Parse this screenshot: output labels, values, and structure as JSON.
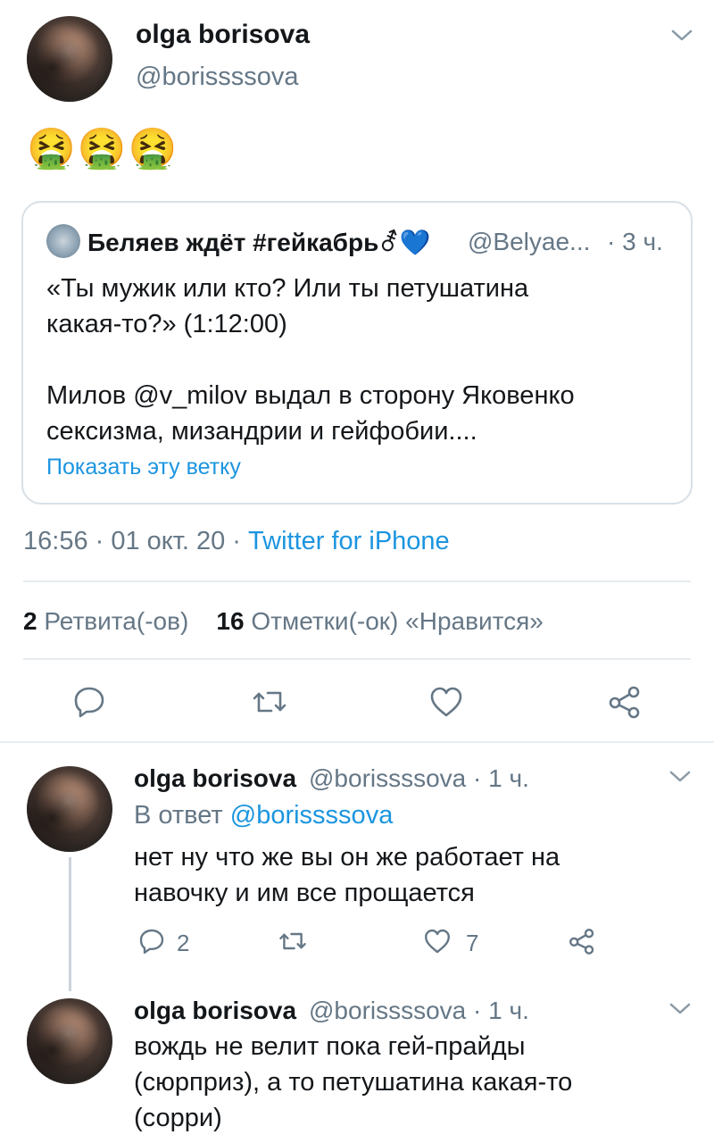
{
  "main_tweet": {
    "author_name": "olga borisova",
    "author_handle": "@borissssova",
    "text": "🤮🤮🤮",
    "quoted": {
      "author_name": "Беляев ждёт #гейкабрь⚦",
      "heart": "💙",
      "author_handle": "@Belyae...",
      "time": "· 3 ч.",
      "lines": [
        "«Ты мужик или кто? Или ты петушатина",
        "какая-то?» (1:12:00)",
        "Милов @v_milov выдал в сторону Яковенко",
        "сексизма, мизандрии и гейфобии...."
      ],
      "show_thread": "Показать эту ветку"
    },
    "timestamp": "16:56 · 01 окт. 20 · ",
    "source": "Twitter for iPhone",
    "retweets_count": "2",
    "retweets_label": "Ретвита(-ов)",
    "likes_count": "16",
    "likes_label": "Отметки(-ок) «Нравится»"
  },
  "replies": [
    {
      "author_name": "olga borisova",
      "author_handle": "@borissssova · 1 ч.",
      "reply_to_prefix": "В ответ ",
      "reply_to_handle": "@borissssova",
      "lines": [
        "нет ну что же вы он же работает на",
        "навочку и им все прощается"
      ],
      "reply_count": "2",
      "like_count": "7"
    },
    {
      "author_name": "olga borisova",
      "author_handle": "@borissssova · 1 ч.",
      "lines": [
        "вождь не велит пока гей-прайды",
        "(сюрприз), а то петушатина какая-то",
        "(сорри)"
      ]
    }
  ],
  "icons": {
    "reply": "comment-bubble-icon",
    "retweet": "retweet-icon",
    "like": "heart-icon",
    "share": "share-icon",
    "menu": "chevron-down-icon"
  },
  "colors": {
    "link": "#1b95e0",
    "secondary": "#657786",
    "border": "#e6ecf0"
  }
}
